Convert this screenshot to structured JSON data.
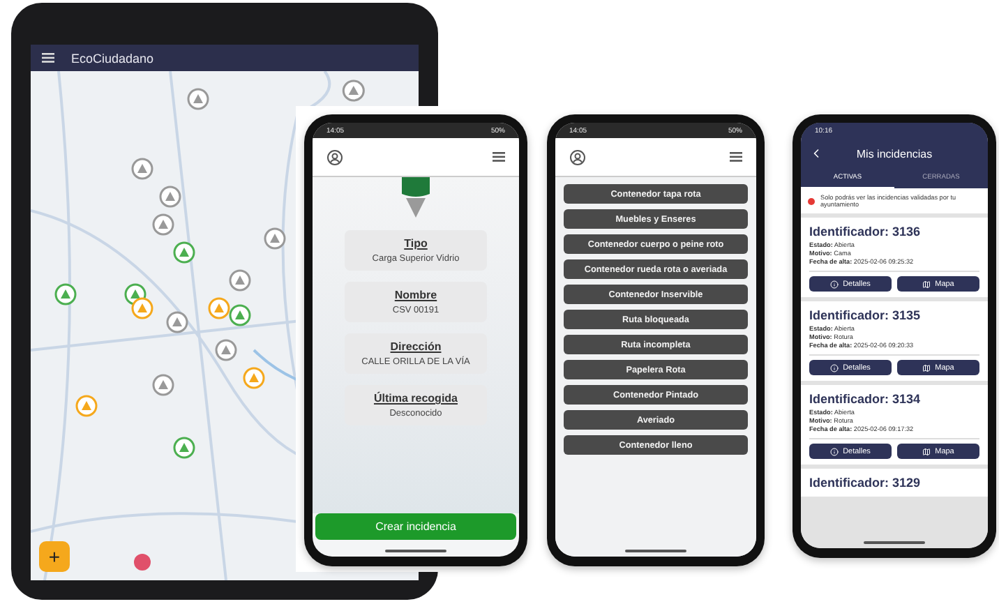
{
  "tablet": {
    "app_title": "EcoCiudadano",
    "fab": "+"
  },
  "detail_phone": {
    "status_time": "14:05",
    "status_battery": "50%",
    "fields": [
      {
        "label": "Tipo",
        "value": "Carga Superior Vidrio"
      },
      {
        "label": "Nombre",
        "value": "CSV 00191"
      },
      {
        "label": "Dirección",
        "value": "CALLE ORILLA DE LA VÍA"
      },
      {
        "label": "Última recogida",
        "value": "Desconocido"
      }
    ],
    "action": "Crear incidencia"
  },
  "category_phone": {
    "status_time": "14:05",
    "status_battery": "50%",
    "categories": [
      "Contenedor tapa rota",
      "Muebles y Enseres",
      "Contenedor cuerpo o peine roto",
      "Contenedor rueda rota o averiada",
      "Contenedor Inservible",
      "Ruta bloqueada",
      "Ruta incompleta",
      "Papelera Rota",
      "Contenedor Pintado",
      "Averiado",
      "Contenedor lleno"
    ]
  },
  "incidents_phone": {
    "status_time": "10:16",
    "title": "Mis incidencias",
    "tabs": [
      {
        "label": "ACTIVAS",
        "selected": true
      },
      {
        "label": "CERRADAS",
        "selected": false
      }
    ],
    "notice": "Solo podrás ver las incidencias validadas por tu ayuntamiento",
    "incidents": [
      {
        "id": "Identificador: 3136",
        "fields": [
          {
            "label": "Estado:",
            "value": "Abierta"
          },
          {
            "label": "Motivo:",
            "value": "Cama"
          },
          {
            "label": "Fecha de alta:",
            "value": "2025-02-06 09:25:32"
          }
        ],
        "buttons": [
          {
            "kind": "details",
            "label": "Detalles"
          },
          {
            "kind": "map",
            "label": "Mapa"
          }
        ]
      },
      {
        "id": "Identificador: 3135",
        "fields": [
          {
            "label": "Estado:",
            "value": "Abierta"
          },
          {
            "label": "Motivo:",
            "value": "Rotura"
          },
          {
            "label": "Fecha de alta:",
            "value": "2025-02-06 09:20:33"
          }
        ],
        "buttons": [
          {
            "kind": "details",
            "label": "Detalles"
          },
          {
            "kind": "map",
            "label": "Mapa"
          }
        ]
      },
      {
        "id": "Identificador: 3134",
        "fields": [
          {
            "label": "Estado:",
            "value": "Abierta"
          },
          {
            "label": "Motivo:",
            "value": "Rotura"
          },
          {
            "label": "Fecha de alta:",
            "value": "2025-02-06 09:17:32"
          }
        ],
        "buttons": [
          {
            "kind": "details",
            "label": "Detalles"
          },
          {
            "kind": "map",
            "label": "Mapa"
          }
        ]
      },
      {
        "id": "Identificador: 3129"
      }
    ]
  }
}
